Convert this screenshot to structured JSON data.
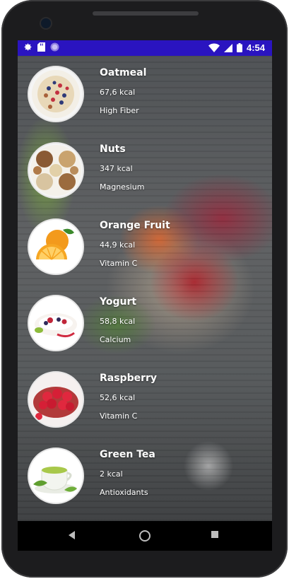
{
  "status_bar": {
    "time": "4:54",
    "left_icons": [
      "gear-icon",
      "sd-card-icon",
      "circle-icon"
    ],
    "right_icons": [
      "wifi-icon",
      "cell-signal-icon",
      "battery-icon"
    ]
  },
  "items": [
    {
      "name": "Oatmeal",
      "kcal": "67,6 kcal",
      "benefit": "High Fiber",
      "icon": "oatmeal-bowl-image"
    },
    {
      "name": "Nuts",
      "kcal": "347 kcal",
      "benefit": "Magnesium",
      "icon": "nuts-plate-image"
    },
    {
      "name": "Orange Fruit",
      "kcal": "44,9 kcal",
      "benefit": "Vitamin C",
      "icon": "orange-fruit-image"
    },
    {
      "name": "Yogurt",
      "kcal": "58,8 kcal",
      "benefit": "Calcium",
      "icon": "yogurt-bowl-image"
    },
    {
      "name": "Raspberry",
      "kcal": "52,6 kcal",
      "benefit": "Vitamin C",
      "icon": "raspberry-bowl-image"
    },
    {
      "name": "Green Tea",
      "kcal": "2 kcal",
      "benefit": "Antioxidants",
      "icon": "green-tea-cup-image"
    }
  ],
  "nav_bar": {
    "buttons": [
      "back-icon",
      "home-icon",
      "recents-icon"
    ]
  },
  "colors": {
    "status_bar": "#2a14c0",
    "text": "#ffffff"
  }
}
